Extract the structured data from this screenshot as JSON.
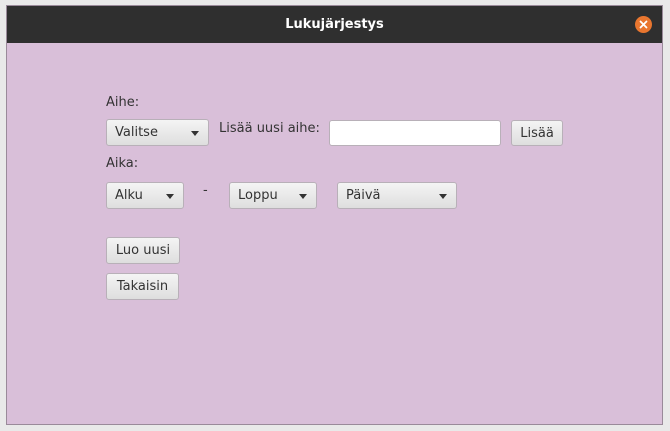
{
  "window": {
    "title": "Lukujärjestys"
  },
  "form": {
    "subject_label": "Aihe:",
    "subject_select": {
      "selected": "Valitse"
    },
    "new_subject_label": "Lisää uusi aihe:",
    "new_subject_input": {
      "value": "",
      "placeholder": ""
    },
    "add_button": "Lisää",
    "time_label": "Aika:",
    "start_select": {
      "selected": "Alku"
    },
    "range_separator": "-",
    "end_select": {
      "selected": "Loppu"
    },
    "day_select": {
      "selected": "Päivä"
    },
    "create_button": "Luo uusi",
    "back_button": "Takaisin"
  },
  "colors": {
    "background": "#d9bfd9",
    "titlebar": "#2f2f2f",
    "close_button": "#e9762f"
  },
  "icons": {
    "close": "close-icon",
    "dropdown": "chevron-down-icon"
  }
}
